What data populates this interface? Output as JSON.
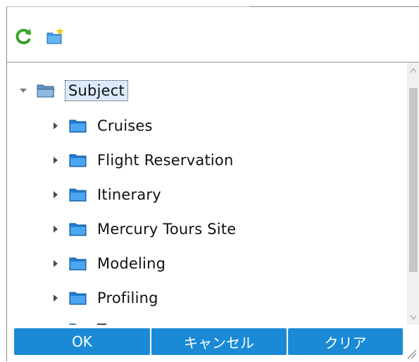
{
  "toolbar": {
    "refresh_icon": "refresh-icon",
    "new_folder_icon": "new-folder-icon"
  },
  "tree": {
    "root": {
      "label": "Subject",
      "expanded": true,
      "selected": true
    },
    "children": [
      {
        "label": "Cruises",
        "expanded": false
      },
      {
        "label": "Flight Reservation",
        "expanded": false
      },
      {
        "label": "Itinerary",
        "expanded": false
      },
      {
        "label": "Mercury Tours Site",
        "expanded": false
      },
      {
        "label": "Modeling",
        "expanded": false
      },
      {
        "label": "Profiling",
        "expanded": false
      },
      {
        "label": "T",
        "expanded": false
      }
    ]
  },
  "footer": {
    "ok_label": "OK",
    "cancel_label": "キャンセル",
    "clear_label": "クリア"
  },
  "colors": {
    "button_bg": "#1a8ad6",
    "selection_bg": "#dcebfb",
    "folder_blue": "#2a8fe0"
  }
}
